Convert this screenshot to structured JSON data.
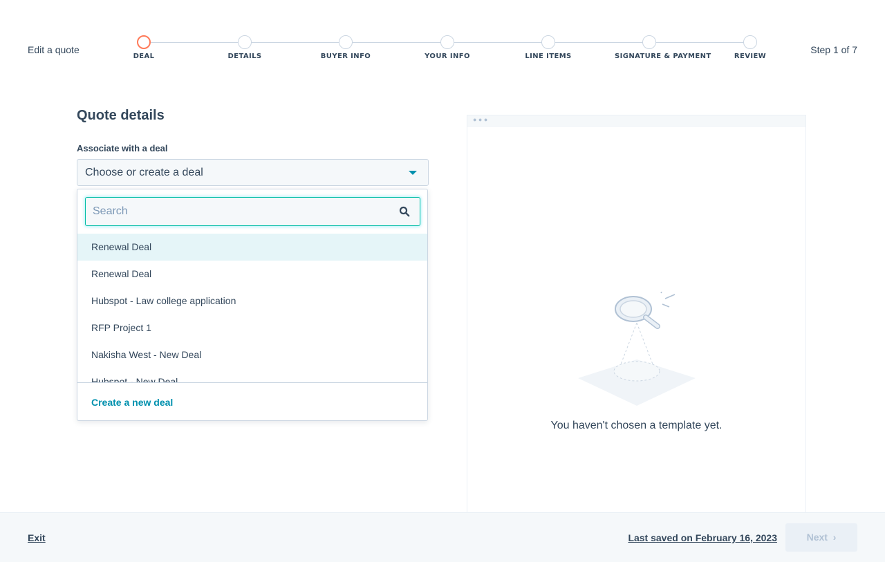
{
  "header": {
    "title": "Edit a quote",
    "step_count": "Step 1 of 7",
    "steps": [
      {
        "label": "DEAL",
        "active": true
      },
      {
        "label": "DETAILS",
        "active": false
      },
      {
        "label": "BUYER INFO",
        "active": false
      },
      {
        "label": "YOUR INFO",
        "active": false
      },
      {
        "label": "LINE ITEMS",
        "active": false
      },
      {
        "label": "SIGNATURE & PAYMENT",
        "active": false
      },
      {
        "label": "REVIEW",
        "active": false
      }
    ]
  },
  "form": {
    "section_title": "Quote details",
    "deal_label": "Associate with a deal",
    "deal_select_value": "Choose or create a deal"
  },
  "dropdown": {
    "search_placeholder": "Search",
    "search_value": "",
    "options": [
      "Renewal Deal",
      "Renewal Deal",
      "Hubspot - Law college application",
      "RFP Project 1",
      "Nakisha West - New Deal",
      "Hubspot - New Deal"
    ],
    "create_label": "Create a new deal"
  },
  "preview": {
    "empty_message": "You haven't chosen a template yet."
  },
  "footer": {
    "exit_label": "Exit",
    "saved_label": "Last saved on February 16, 2023",
    "next_label": "Next"
  },
  "colors": {
    "accent": "#0091ae",
    "active_step": "#ff7a59",
    "text": "#33475b",
    "focus_border": "#00bda5"
  }
}
